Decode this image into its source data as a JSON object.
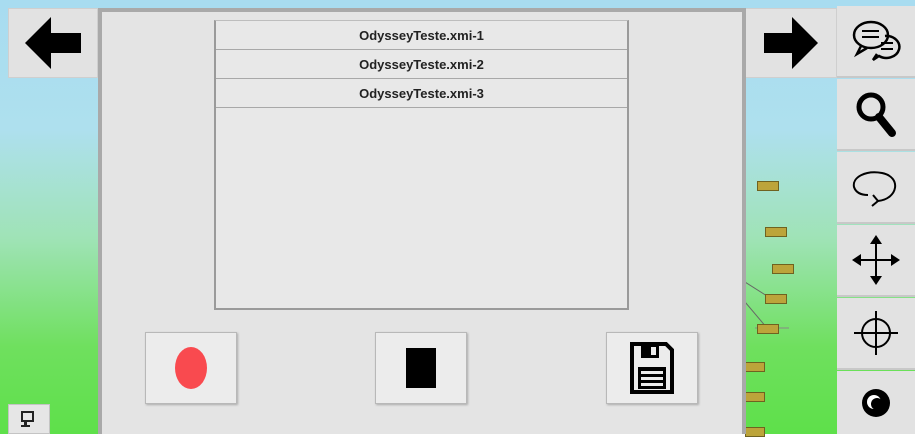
{
  "nav": {
    "back_icon": "arrow-left-icon",
    "forward_icon": "arrow-right-icon"
  },
  "file_list": {
    "items": [
      {
        "label": "OdysseyTeste.xmi-1"
      },
      {
        "label": "OdysseyTeste.xmi-2"
      },
      {
        "label": "OdysseyTeste.xmi-3"
      }
    ]
  },
  "controls": {
    "record_icon": "record-icon",
    "stop_icon": "stop-icon",
    "save_icon": "floppy-disk-save-icon",
    "record_color": "#f94a4f",
    "stop_color": "#000000"
  },
  "toolbar": {
    "items": [
      {
        "icon": "chat-bubbles-icon"
      },
      {
        "icon": "magnifier-icon"
      },
      {
        "icon": "rotate-loop-icon"
      },
      {
        "icon": "move-arrows-icon"
      },
      {
        "icon": "crosshair-icon"
      },
      {
        "icon": "eye-icon"
      }
    ]
  },
  "colors": {
    "panel_bg": "#e4e4e4",
    "panel_border": "#a9a9a9",
    "sky_top": "#a8dcf0",
    "ground": "#5ee04a"
  }
}
